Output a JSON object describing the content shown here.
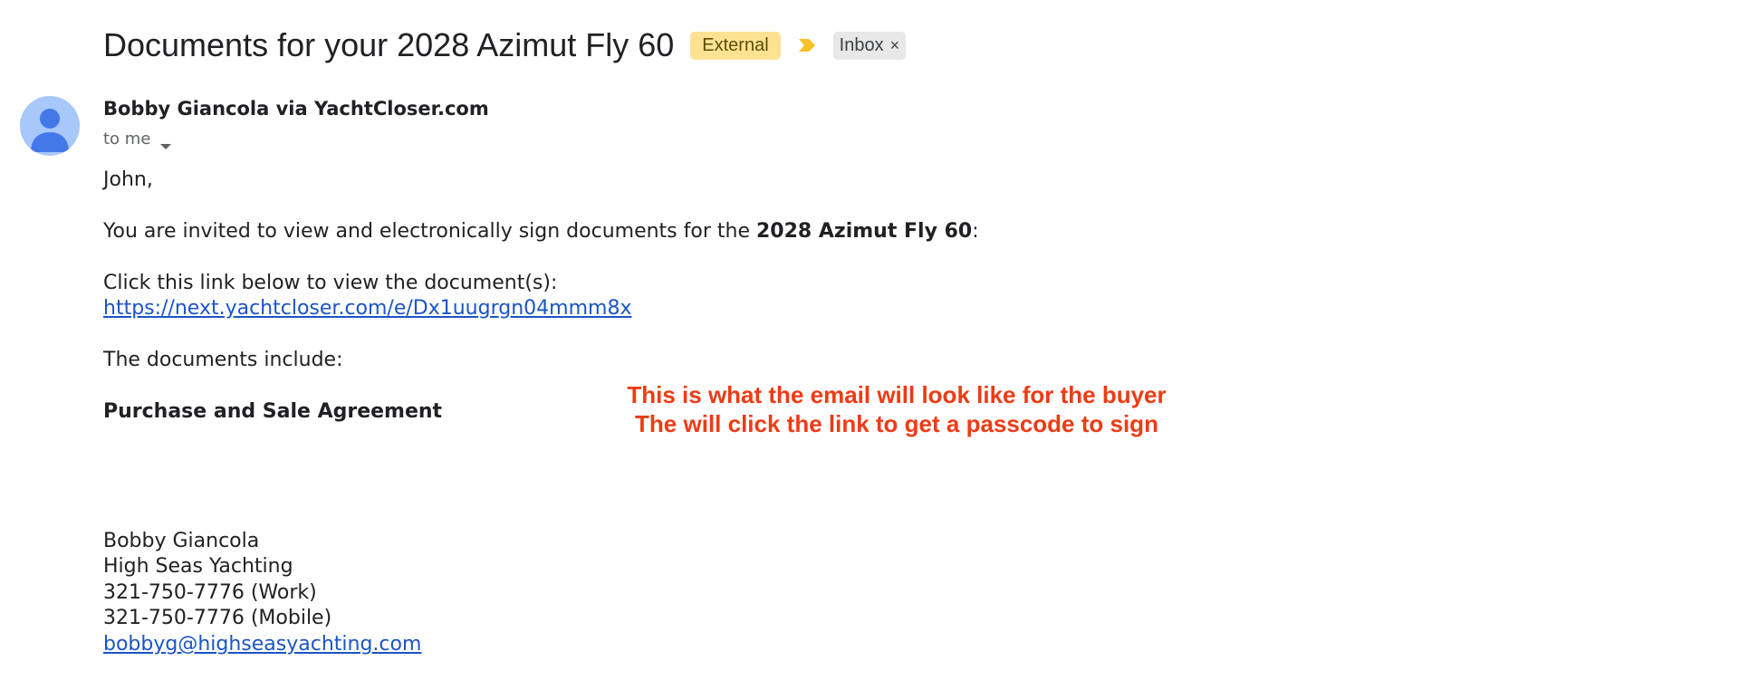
{
  "subject": {
    "title": "Documents for your 2028 Azimut Fly 60",
    "external_label": "External",
    "inbox_label": "Inbox",
    "inbox_close": "×",
    "importance_icon": "importance-marker-icon",
    "external_color": "#fde293"
  },
  "sender": {
    "name": "Bobby Giancola via YachtCloser.com",
    "to": "to me",
    "avatar_icon": "person-icon",
    "avatar_color": "#a8c7fa"
  },
  "body": {
    "greeting": "John,",
    "invite_prefix": "You are invited to view and electronically sign documents for the ",
    "invite_bold": "2028 Azimut Fly 60",
    "invite_suffix": ":",
    "click_text": "Click this link below to view the document(s):",
    "document_link": "https://next.yachtcloser.com/e/Dx1uugrgn04mmm8x",
    "includes_text": "The documents include:",
    "document_name": "Purchase and Sale Agreement"
  },
  "signature": {
    "name": "Bobby Giancola",
    "company": "High Seas Yachting",
    "work_phone": "321-750-7776 (Work)",
    "mobile_phone": "321-750-7776 (Mobile)",
    "email": "bobbyg@highseasyachting.com"
  },
  "annotation": {
    "line1": "This is what the email will look like for the buyer",
    "line2": "The will click the link to get a passcode to sign",
    "color": "#ee3b14"
  }
}
